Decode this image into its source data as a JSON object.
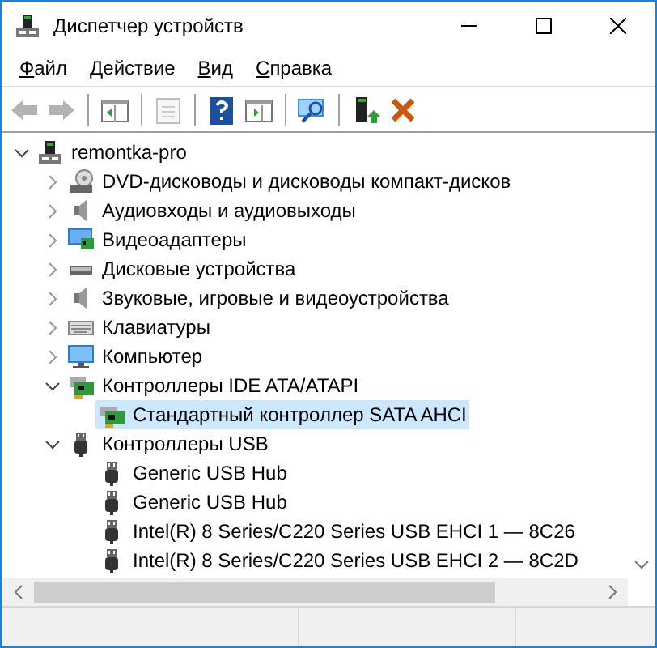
{
  "window": {
    "title": "Диспетчер устройств"
  },
  "menu": [
    {
      "label": "Файл"
    },
    {
      "label": "Действие"
    },
    {
      "label": "Вид"
    },
    {
      "label": "Справка"
    }
  ],
  "toolbar": [
    {
      "kind": "back",
      "disabled": true
    },
    {
      "kind": "forward",
      "disabled": true
    },
    {
      "kind": "separator"
    },
    {
      "kind": "console-tree",
      "disabled": false
    },
    {
      "kind": "separator"
    },
    {
      "kind": "properties",
      "disabled": true
    },
    {
      "kind": "separator"
    },
    {
      "kind": "help",
      "disabled": false
    },
    {
      "kind": "action-pane",
      "disabled": false
    },
    {
      "kind": "separator"
    },
    {
      "kind": "scan",
      "disabled": false
    },
    {
      "kind": "separator"
    },
    {
      "kind": "update-driver",
      "disabled": false
    },
    {
      "kind": "remove",
      "disabled": false
    }
  ],
  "tree": {
    "label": "remontka-pro",
    "kind": "computer-root",
    "expanded": true,
    "selected": false,
    "children": [
      {
        "label": "DVD-дисководы и дисководы компакт-дисков",
        "kind": "dvd",
        "expanded": false,
        "selected": false
      },
      {
        "label": "Аудиовходы и аудиовыходы",
        "kind": "audio",
        "expanded": false,
        "selected": false
      },
      {
        "label": "Видеоадаптеры",
        "kind": "display",
        "expanded": false,
        "selected": false
      },
      {
        "label": "Дисковые устройства",
        "kind": "disk",
        "expanded": false,
        "selected": false
      },
      {
        "label": "Звуковые, игровые и видеоустройства",
        "kind": "audio",
        "expanded": false,
        "selected": false
      },
      {
        "label": "Клавиатуры",
        "kind": "keyboard",
        "expanded": false,
        "selected": false
      },
      {
        "label": "Компьютер",
        "kind": "computer",
        "expanded": false,
        "selected": false
      },
      {
        "label": "Контроллеры IDE ATA/ATAPI",
        "kind": "ide",
        "expanded": true,
        "selected": false,
        "children": [
          {
            "label": "Стандартный контроллер SATA AHCI",
            "kind": "ide",
            "selected": true
          }
        ]
      },
      {
        "label": "Контроллеры USB",
        "kind": "usb",
        "expanded": true,
        "selected": false,
        "children": [
          {
            "label": "Generic USB Hub",
            "kind": "usb",
            "selected": false
          },
          {
            "label": "Generic USB Hub",
            "kind": "usb",
            "selected": false
          },
          {
            "label": "Intel(R) 8 Series/C220 Series USB EHCI 1 — 8C26",
            "kind": "usb",
            "selected": false
          },
          {
            "label": "Intel(R) 8 Series/C220 Series USB EHCI 2 — 8C2D",
            "kind": "usb",
            "selected": false
          }
        ]
      }
    ]
  }
}
